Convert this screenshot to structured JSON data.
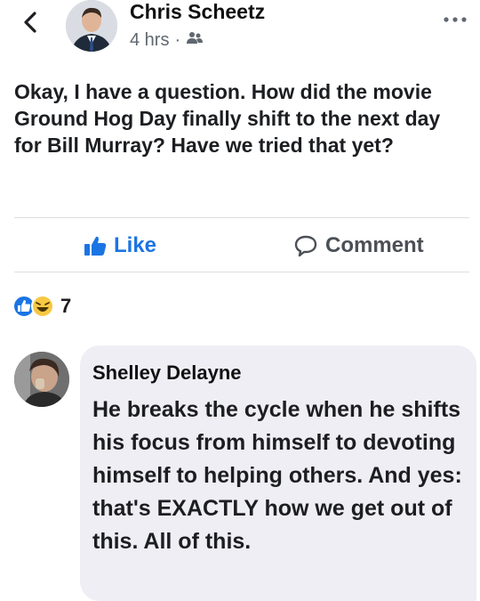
{
  "post": {
    "author": "Chris Scheetz",
    "time": "4 hrs",
    "separator": "·",
    "privacy_icon": "friends-icon",
    "text": "Okay, I have a question. How did the movie Ground Hog Day finally shift to the next day for Bill Murray? Have we tried that yet?"
  },
  "actions": {
    "like_label": "Like",
    "comment_label": "Comment"
  },
  "reactions": {
    "icons": [
      "like-reaction-icon",
      "haha-reaction-icon"
    ],
    "count": "7"
  },
  "comment": {
    "author": "Shelley Delayne",
    "text": "He breaks the cycle when he shifts his focus from himself to devoting himself to helping others. And yes: that's EXACTLY how we get out of this. All of this."
  },
  "colors": {
    "accent": "#1b74e4",
    "bubble": "#f0eef5",
    "muted": "#606770"
  }
}
